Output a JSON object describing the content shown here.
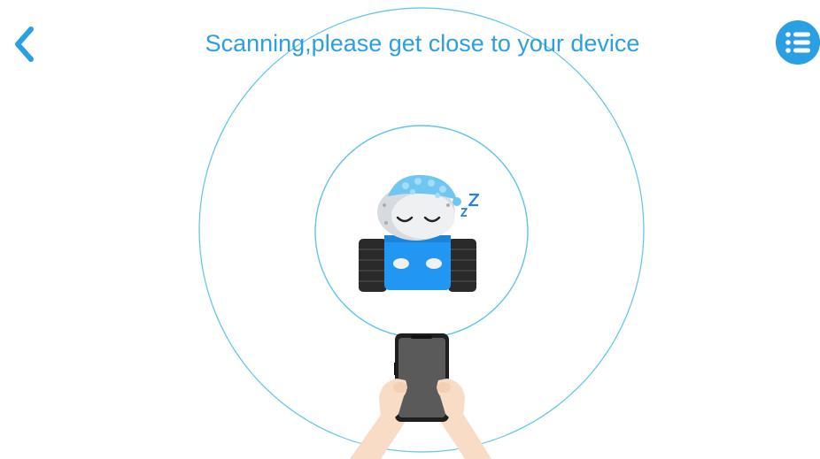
{
  "header": {
    "title": "Scanning,please get close to your device"
  },
  "icons": {
    "back": "chevron-left-icon",
    "menu": "list-menu-icon"
  },
  "colors": {
    "accent": "#2b9fe3",
    "ring": "#5ec3ea",
    "robot_body": "#2196f3",
    "robot_cap": "#6ec6f1",
    "tracks": "#2b2b2b"
  }
}
